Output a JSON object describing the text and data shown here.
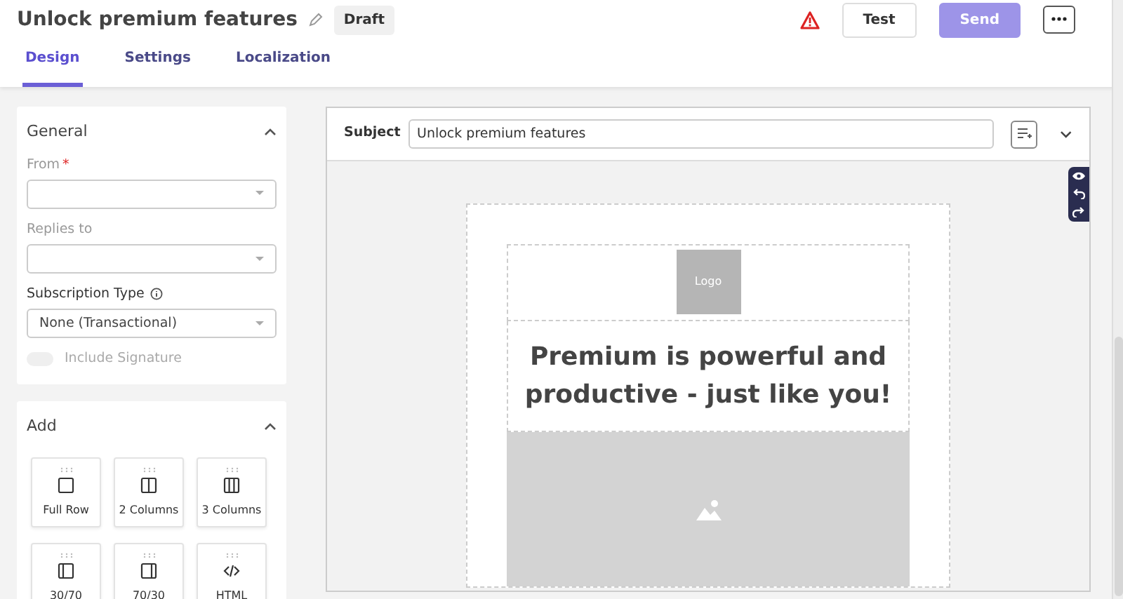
{
  "header": {
    "title": "Unlock premium features",
    "status": "Draft",
    "buttons": [
      {
        "label": "Test",
        "disabled": false
      },
      {
        "label": "Send",
        "disabled": true
      }
    ]
  },
  "tabs": [
    {
      "label": "Design",
      "selected": true
    },
    {
      "label": "Settings",
      "selected": false
    },
    {
      "label": "Localization",
      "selected": false
    }
  ],
  "general": {
    "title": "General",
    "fields": [
      {
        "label": "From",
        "required_mark": "*",
        "info": false
      },
      {
        "label": "Replies to",
        "info": false
      },
      {
        "label": "Subscription Type",
        "info": true,
        "value": "None (Transactional)"
      }
    ],
    "toggle": {
      "label": "Include Signature",
      "on": false,
      "disabled": true
    }
  },
  "add": {
    "title": "Add",
    "blocks": [
      {
        "label": "Full Row",
        "kind": "full"
      },
      {
        "label": "2 Columns",
        "kind": "two"
      },
      {
        "label": "3 Columns",
        "kind": "three"
      },
      {
        "label": "30/70",
        "kind": "left"
      },
      {
        "label": "70/30",
        "kind": "right"
      },
      {
        "label": "HTML",
        "kind": "html"
      }
    ]
  },
  "editor": {
    "subject_label": "Subject",
    "subject": "Unlock premium features",
    "logo": "Logo",
    "headline": "Premium is powerful and productive - just like you!"
  }
}
